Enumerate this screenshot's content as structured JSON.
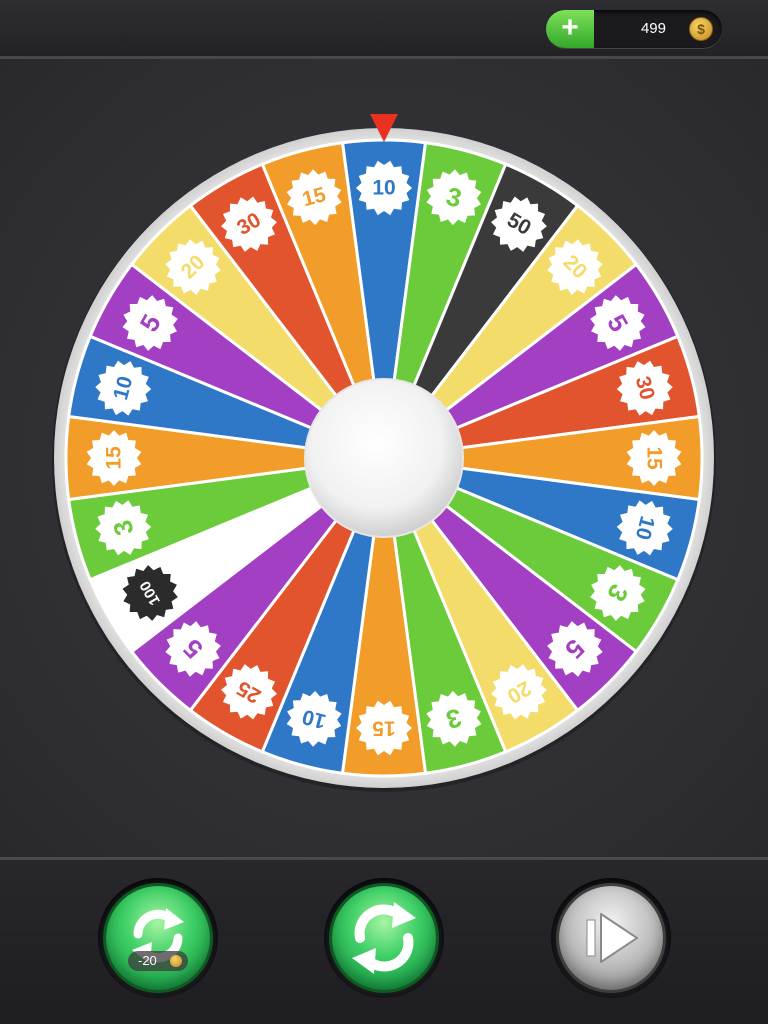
{
  "header": {
    "coin_balance": "499",
    "add_coins_label": "+",
    "coin_symbol": "$"
  },
  "wheel": {
    "segments": [
      {
        "value": "10",
        "color": "#2f78c8"
      },
      {
        "value": "3",
        "color": "#6ccb3a"
      },
      {
        "value": "50",
        "color": "#3a3a3a"
      },
      {
        "value": "20",
        "color": "#f4dc6a"
      },
      {
        "value": "5",
        "color": "#a23fc2"
      },
      {
        "value": "30",
        "color": "#e2542d"
      },
      {
        "value": "15",
        "color": "#f29d2a"
      },
      {
        "value": "10",
        "color": "#2f78c8"
      },
      {
        "value": "3",
        "color": "#6ccb3a"
      },
      {
        "value": "5",
        "color": "#a23fc2"
      },
      {
        "value": "20",
        "color": "#f4dc6a"
      },
      {
        "value": "3",
        "color": "#6ccb3a"
      },
      {
        "value": "15",
        "color": "#f29d2a"
      },
      {
        "value": "10",
        "color": "#2f78c8"
      },
      {
        "value": "25",
        "color": "#e2542d"
      },
      {
        "value": "5",
        "color": "#a23fc2"
      },
      {
        "value": "100",
        "color": "#ffffff"
      },
      {
        "value": "3",
        "color": "#6ccb3a"
      },
      {
        "value": "15",
        "color": "#f29d2a"
      },
      {
        "value": "10",
        "color": "#2f78c8"
      },
      {
        "value": "5",
        "color": "#a23fc2"
      },
      {
        "value": "20",
        "color": "#f4dc6a"
      },
      {
        "value": "30",
        "color": "#e2542d"
      },
      {
        "value": "15",
        "color": "#f29d2a"
      }
    ],
    "pointer_color": "#e8311f"
  },
  "controls": {
    "paid_spin_cost": "-20",
    "colors": {
      "green": "#2fbf5a",
      "grey": "#a0a0a0"
    },
    "icons": [
      "paid-spin-icon",
      "free-spin-icon",
      "skip-icon"
    ]
  }
}
